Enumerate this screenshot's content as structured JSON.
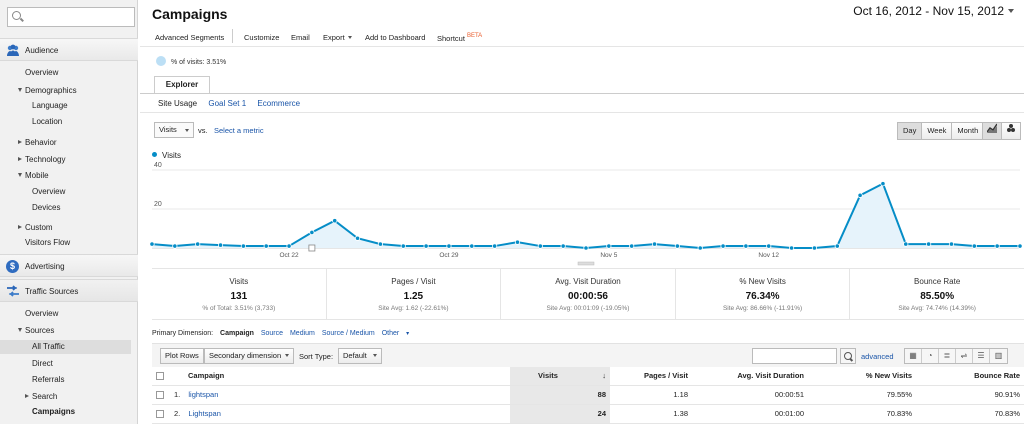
{
  "sidebar": {
    "search_placeholder": "",
    "sections": {
      "audience": "Audience",
      "advertising": "Advertising",
      "traffic_sources": "Traffic Sources"
    },
    "audience_items": {
      "overview": "Overview",
      "demographics": "Demographics",
      "language": "Language",
      "location": "Location",
      "behavior": "Behavior",
      "technology": "Technology",
      "mobile": "Mobile",
      "mobile_overview": "Overview",
      "devices": "Devices",
      "custom": "Custom",
      "visitors_flow": "Visitors Flow"
    },
    "traffic_items": {
      "overview": "Overview",
      "sources": "Sources",
      "all_traffic": "All Traffic",
      "direct": "Direct",
      "referrals": "Referrals",
      "search": "Search",
      "campaigns": "Campaigns"
    }
  },
  "header": {
    "title": "Campaigns",
    "date_range": "Oct 16, 2012 - Nov 15, 2012"
  },
  "toolbar": {
    "advanced_segments": "Advanced Segments",
    "customize": "Customize",
    "email": "Email",
    "export": "Export",
    "add_to_dashboard": "Add to Dashboard",
    "shortcut": "Shortcut",
    "beta": "BETA"
  },
  "segment": {
    "label": "% of visits: 3.51%"
  },
  "tabs": {
    "explorer": "Explorer",
    "site_usage": "Site Usage",
    "goal_set": "Goal Set 1",
    "ecommerce": "Ecommerce"
  },
  "chart_controls": {
    "metric": "Visits",
    "vs": "vs.",
    "select_metric": "Select a metric",
    "day": "Day",
    "week": "Week",
    "month": "Month"
  },
  "chart_data": {
    "type": "area",
    "series": [
      {
        "name": "Visits",
        "values": [
          2,
          1,
          2,
          1.5,
          1,
          1,
          1,
          8,
          14,
          5,
          2,
          1,
          1,
          1,
          1,
          1,
          3,
          1,
          1,
          0,
          1,
          1,
          2,
          1,
          0,
          1,
          1,
          1,
          0,
          0,
          1,
          27,
          33,
          2,
          2,
          2,
          1,
          1,
          1
        ]
      }
    ],
    "x_ticks": [
      "Oct 22",
      "Oct 29",
      "Nov 5",
      "Nov 12"
    ],
    "y_ticks": [
      "20",
      "40"
    ],
    "ylim": [
      0,
      40
    ],
    "color": "#058dc7",
    "fill": "#e6f3fb"
  },
  "stats": [
    {
      "label": "Visits",
      "value": "131",
      "sub": "% of Total: 3.51% (3,733)"
    },
    {
      "label": "Pages / Visit",
      "value": "1.25",
      "sub": "Site Avg: 1.62 (-22.61%)"
    },
    {
      "label": "Avg. Visit Duration",
      "value": "00:00:56",
      "sub": "Site Avg: 00:01:09 (-19.05%)"
    },
    {
      "label": "% New Visits",
      "value": "76.34%",
      "sub": "Site Avg: 86.66% (-11.91%)"
    },
    {
      "label": "Bounce Rate",
      "value": "85.50%",
      "sub": "Site Avg: 74.74% (14.39%)"
    }
  ],
  "primary_dimension": {
    "label": "Primary Dimension:",
    "current": "Campaign",
    "source": "Source",
    "medium": "Medium",
    "source_medium": "Source / Medium",
    "other": "Other"
  },
  "table_controls": {
    "plot_rows": "Plot Rows",
    "secondary_dimension": "Secondary dimension",
    "sort_type_label": "Sort Type:",
    "sort_default": "Default",
    "advanced": "advanced"
  },
  "table": {
    "headers": {
      "campaign": "Campaign",
      "visits": "Visits",
      "pages_visit": "Pages / Visit",
      "duration": "Avg. Visit Duration",
      "new_visits": "% New Visits",
      "bounce": "Bounce Rate"
    },
    "rows": [
      {
        "num": "1.",
        "campaign": "lightspan",
        "visits": "88",
        "pages": "1.18",
        "duration": "00:00:51",
        "new": "79.55%",
        "bounce": "90.91%"
      },
      {
        "num": "2.",
        "campaign": "Lightspan",
        "visits": "24",
        "pages": "1.38",
        "duration": "00:01:00",
        "new": "70.83%",
        "bounce": "70.83%"
      }
    ]
  }
}
